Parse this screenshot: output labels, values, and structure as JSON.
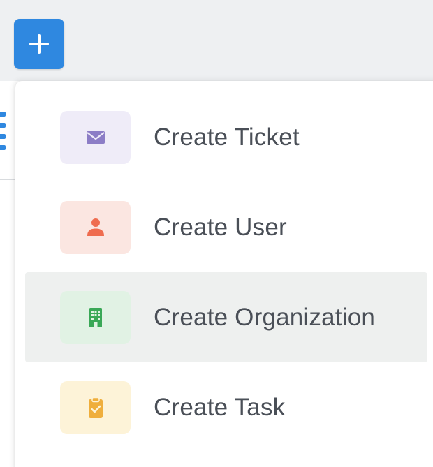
{
  "toolbar": {
    "add_icon": "plus-icon",
    "add_color": "#2f88e0"
  },
  "menu": {
    "items": [
      {
        "label": "Create Ticket",
        "icon": "envelope-icon",
        "icon_color": "#8c7dc6",
        "bg_color": "#efecf8",
        "active": false
      },
      {
        "label": "Create User",
        "icon": "user-icon",
        "icon_color": "#ef6c4f",
        "bg_color": "#fbe6e1",
        "active": false
      },
      {
        "label": "Create Organization",
        "icon": "building-icon",
        "icon_color": "#3aa857",
        "bg_color": "#e1f2e4",
        "active": true
      },
      {
        "label": "Create Task",
        "icon": "clipboard-check-icon",
        "icon_color": "#efae3c",
        "bg_color": "#fdf3d8",
        "active": false
      }
    ]
  }
}
